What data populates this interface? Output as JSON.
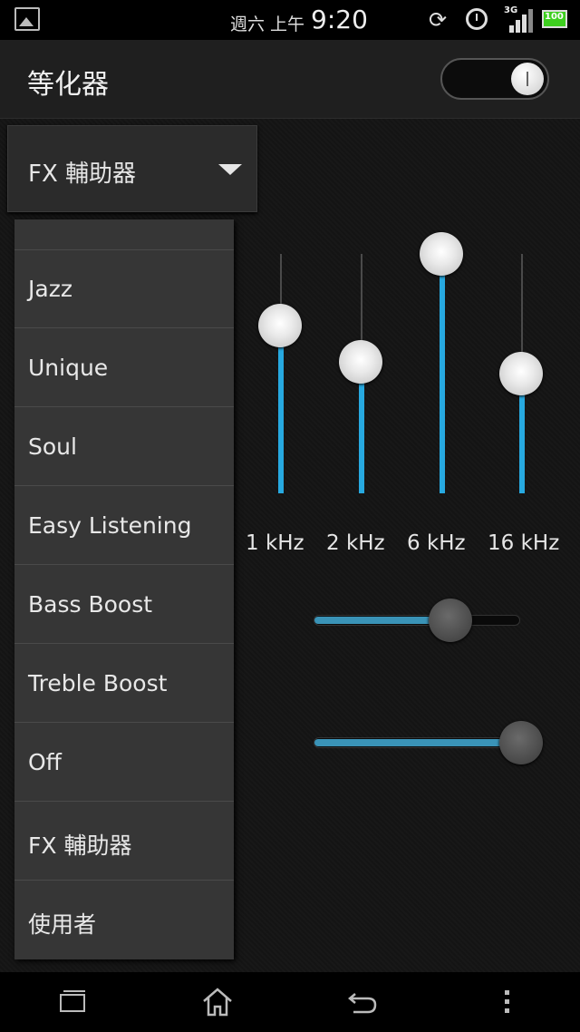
{
  "status_bar": {
    "date": "週六 上午",
    "time": "9:20",
    "network": "3G",
    "battery": "100",
    "icons": [
      "gallery-icon",
      "rotate-icon",
      "alarm-icon",
      "signal-icon",
      "battery-icon"
    ]
  },
  "action_bar": {
    "title": "等化器",
    "toggle_state": "on"
  },
  "spinner": {
    "selected": "FX 輔助器",
    "icon": "dropdown-arrow-icon"
  },
  "equalizer": {
    "bands": [
      {
        "label": "1 kHz",
        "level": 0.7
      },
      {
        "label": "2 kHz",
        "level": 0.55
      },
      {
        "label": "6 kHz",
        "level": 1.0
      },
      {
        "label": "16 kHz",
        "level": 0.5
      }
    ],
    "accent_color": "#27a9e0"
  },
  "sliders": [
    {
      "name": "bass-boost",
      "level": 0.66
    },
    {
      "name": "virtualizer",
      "level": 1.0
    }
  ],
  "dropdown": {
    "items": [
      "Jazz",
      "Unique",
      "Soul",
      "Easy Listening",
      "Bass Boost",
      "Treble Boost",
      "Off",
      "FX 輔助器",
      "使用者"
    ]
  },
  "nav_bar": {
    "icons": [
      "recent-apps-icon",
      "home-icon",
      "back-icon",
      "menu-icon"
    ]
  }
}
